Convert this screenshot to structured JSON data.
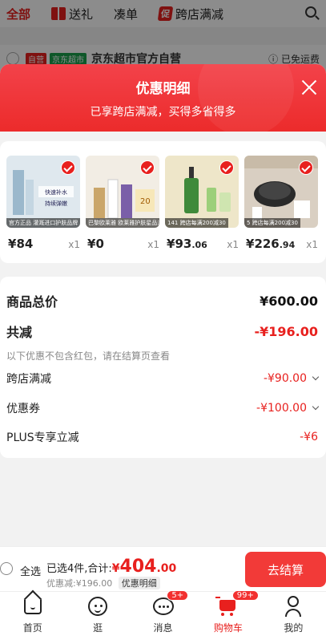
{
  "background": {
    "tabs": [
      {
        "label": "全部",
        "active": true,
        "icon": ""
      },
      {
        "label": "送礼",
        "active": false,
        "icon": "gift-icon"
      },
      {
        "label": "凑单",
        "active": false,
        "icon": ""
      },
      {
        "label": "跨店满减",
        "active": false,
        "icon": "promo-icon",
        "icon_text": "促"
      }
    ],
    "shop": {
      "self_tag": "自营",
      "jd_tag": "京东超市",
      "name": "京东超市官方自营",
      "freeship": "ⓘ 已免运费"
    }
  },
  "panel": {
    "title": "优惠明细",
    "subtitle": "已享跨店满减，买得多省得多"
  },
  "products": [
    {
      "currency": "¥",
      "price_int": "84",
      "price_dec": "",
      "qty": "x1",
      "thumb_bg": "#dfe8ee",
      "tag": "官方正品 灌溉进口护肤品牌"
    },
    {
      "currency": "¥",
      "price_int": "0",
      "price_dec": "",
      "qty": "x1",
      "thumb_bg": "#f2ede4",
      "tag": "巴黎欧莱雅 欧莱雅护肤星品派"
    },
    {
      "currency": "¥",
      "price_int": "93",
      "price_dec": ".06",
      "qty": "x1",
      "thumb_bg": "#eee6c9",
      "tag": "141 跨店每满200减30"
    },
    {
      "currency": "¥",
      "price_int": "226",
      "price_dec": ".94",
      "qty": "x1",
      "thumb_bg": "#d9cfc2",
      "tag": "5 跨店每满200减30"
    }
  ],
  "summary": {
    "total_label": "商品总价",
    "total_value": "¥600.00",
    "reduce_label": "共减",
    "reduce_value": "-¥196.00",
    "note": "以下优惠不包含红包，请在结算页查看",
    "items": [
      {
        "label": "跨店满减",
        "value": "-¥90.00",
        "chevron": true
      },
      {
        "label": "优惠券",
        "value": "-¥100.00",
        "chevron": true
      },
      {
        "label": "PLUS专享立减",
        "value": "-¥6",
        "chevron": false
      }
    ]
  },
  "checkout": {
    "select_all": "全选",
    "selected_text": "已选4件,合计:",
    "total_symbol": "¥",
    "total_int": "404",
    "total_dec": ".00",
    "discount_text": "优惠减:¥196.00",
    "detail_link": "优惠明细",
    "button": "去结算"
  },
  "tabbar": [
    {
      "label": "首页",
      "icon": "home-icon",
      "badge": "",
      "active": false
    },
    {
      "label": "逛",
      "icon": "explore-icon",
      "badge": "",
      "active": false
    },
    {
      "label": "消息",
      "icon": "message-icon",
      "badge": "5+",
      "active": false
    },
    {
      "label": "购物车",
      "icon": "cart-icon",
      "badge": "99+",
      "active": true
    },
    {
      "label": "我的",
      "icon": "profile-icon",
      "badge": "",
      "active": false
    }
  ],
  "colors": {
    "accent": "#e8201e",
    "header": "#ec2b2b"
  }
}
